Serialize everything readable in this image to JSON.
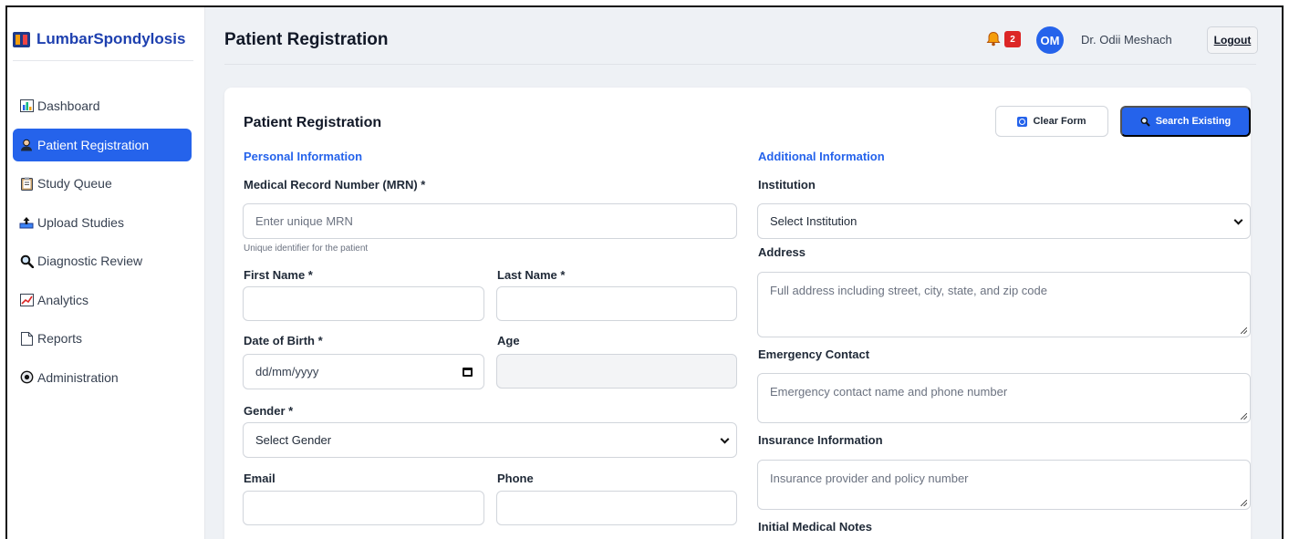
{
  "app": {
    "brand": "LumbarSpondylosis"
  },
  "sidebar": {
    "items": [
      {
        "label": "Dashboard",
        "icon": "bar-chart-icon"
      },
      {
        "label": "Patient Registration",
        "icon": "person-icon",
        "active": true
      },
      {
        "label": "Study Queue",
        "icon": "clipboard-icon"
      },
      {
        "label": "Upload Studies",
        "icon": "upload-tray-icon"
      },
      {
        "label": "Diagnostic Review",
        "icon": "magnifier-icon"
      },
      {
        "label": "Analytics",
        "icon": "line-chart-icon"
      },
      {
        "label": "Reports",
        "icon": "document-icon"
      },
      {
        "label": "Administration",
        "icon": "gear-icon"
      }
    ]
  },
  "header": {
    "title": "Patient Registration",
    "notification_count": "2",
    "avatar_initials": "OM",
    "user_name": "Dr. Odii Meshach",
    "logout_label": "Logout"
  },
  "card": {
    "title": "Patient Registration",
    "clear_label": "Clear Form",
    "search_label": "Search Existing",
    "personal": {
      "section": "Personal Information",
      "mrn_label": "Medical Record Number (MRN) *",
      "mrn_placeholder": "Enter unique MRN",
      "mrn_hint": "Unique identifier for the patient",
      "first_name_label": "First Name *",
      "last_name_label": "Last Name *",
      "dob_label": "Date of Birth *",
      "dob_placeholder": "dd/mm/yyyy",
      "age_label": "Age",
      "gender_label": "Gender *",
      "gender_value": "Select Gender",
      "email_label": "Email",
      "phone_label": "Phone"
    },
    "additional": {
      "section": "Additional Information",
      "institution_label": "Institution",
      "institution_value": "Select Institution",
      "address_label": "Address",
      "address_placeholder": "Full address including street, city, state, and zip code",
      "emergency_label": "Emergency Contact",
      "emergency_placeholder": "Emergency contact name and phone number",
      "insurance_label": "Insurance Information",
      "insurance_placeholder": "Insurance provider and policy number",
      "notes_label": "Initial Medical Notes"
    }
  },
  "colors": {
    "accent": "#2563eb",
    "badge": "#dc2626",
    "bell": "#f59e0b"
  }
}
